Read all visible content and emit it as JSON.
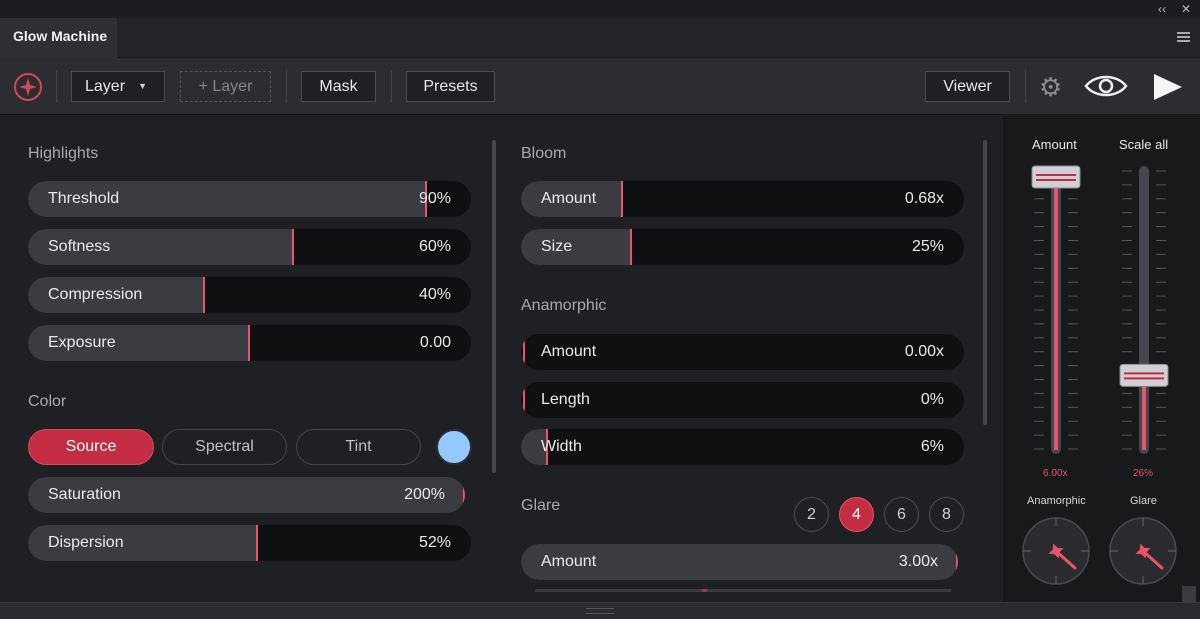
{
  "window": {
    "collapse_glyph": "‹‹",
    "close_glyph": "✕",
    "menu_icon": "hamburger-icon"
  },
  "tab": {
    "title": "Glow Machine"
  },
  "toolbar": {
    "logo_icon": "glow-logo-icon",
    "layer_dropdown": "Layer",
    "add_layer_button": "+ Layer",
    "mask_button": "Mask",
    "presets_button": "Presets",
    "viewer_button": "Viewer",
    "settings_icon": "gear-icon",
    "preview_icon": "eye-icon",
    "render_icon": "play-icon"
  },
  "highlights": {
    "title": "Highlights",
    "sliders": [
      {
        "label": "Threshold",
        "value": "90%",
        "level": 0.9
      },
      {
        "label": "Softness",
        "value": "60%",
        "level": 0.6
      },
      {
        "label": "Compression",
        "value": "40%",
        "level": 0.4
      },
      {
        "label": "Exposure",
        "value": "0.00",
        "level": 0.5
      }
    ]
  },
  "color": {
    "title": "Color",
    "modes": [
      "Source",
      "Spectral",
      "Tint"
    ],
    "active_mode": "Source",
    "swatch_color": "#94c9ff",
    "sliders": [
      {
        "label": "Saturation",
        "value": "200%",
        "level": 1.0
      },
      {
        "label": "Dispersion",
        "value": "52%",
        "level": 0.52
      }
    ]
  },
  "bloom": {
    "title": "Bloom",
    "sliders": [
      {
        "label": "Amount",
        "value": "0.68x",
        "level": 0.23
      },
      {
        "label": "Size",
        "value": "25%",
        "level": 0.25
      }
    ]
  },
  "anamorphic": {
    "title": "Anamorphic",
    "sliders": [
      {
        "label": "Amount",
        "value": "0.00x",
        "level": 0.0
      },
      {
        "label": "Length",
        "value": "0%",
        "level": 0.0
      },
      {
        "label": "Width",
        "value": "6%",
        "level": 0.06
      }
    ]
  },
  "glare": {
    "title": "Glare",
    "streak_options": [
      "2",
      "4",
      "6",
      "8"
    ],
    "active_streaks": "4",
    "sliders": [
      {
        "label": "Amount",
        "value": "3.00x",
        "level": 1.0
      }
    ]
  },
  "side": {
    "faders": [
      {
        "label": "Amount",
        "value": "6.00x",
        "level": 1.0
      },
      {
        "label": "Scale all",
        "value": "26%",
        "level": 0.26
      }
    ],
    "knobs": [
      {
        "label": "Anamorphic"
      },
      {
        "label": "Glare"
      }
    ]
  },
  "colors": {
    "accent": "#e85468",
    "accent_fill": "#c42c43",
    "track": "#0f1012",
    "slider_fill": "#3b3c42"
  }
}
